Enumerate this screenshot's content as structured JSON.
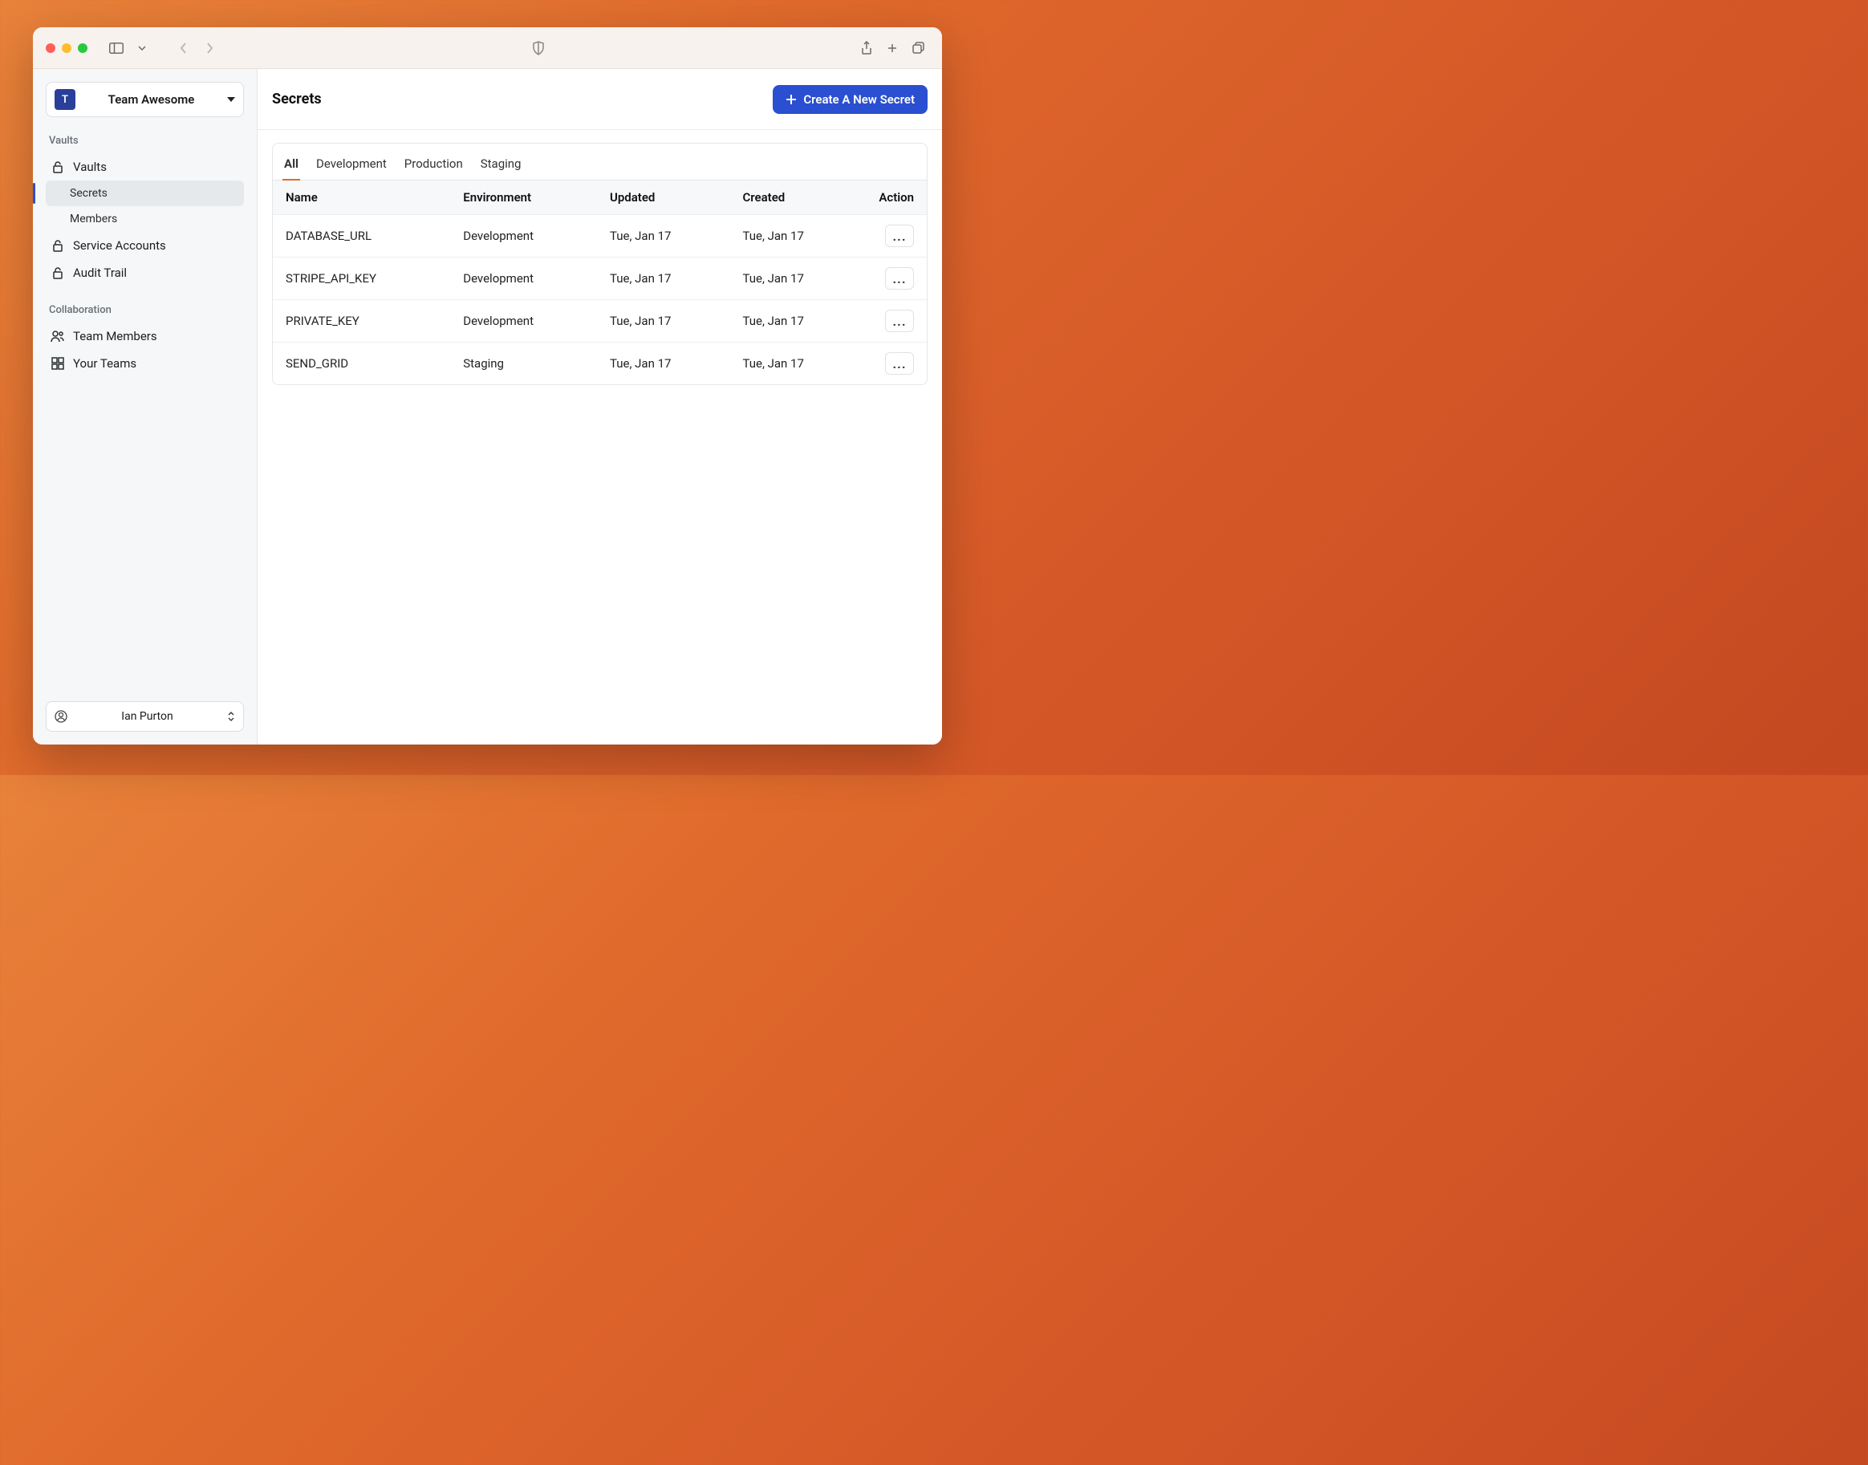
{
  "sidebar": {
    "team": {
      "badge": "T",
      "name": "Team Awesome"
    },
    "section_vaults": "Vaults",
    "nav_vaults": "Vaults",
    "nav_secrets": "Secrets",
    "nav_members": "Members",
    "nav_service_accounts": "Service Accounts",
    "nav_audit_trail": "Audit Trail",
    "section_collab": "Collaboration",
    "nav_team_members": "Team Members",
    "nav_your_teams": "Your Teams",
    "user_name": "Ian Purton"
  },
  "header": {
    "title": "Secrets",
    "create_button": "Create A New Secret"
  },
  "tabs": {
    "all": "All",
    "development": "Development",
    "production": "Production",
    "staging": "Staging"
  },
  "table": {
    "headers": {
      "name": "Name",
      "environment": "Environment",
      "updated": "Updated",
      "created": "Created",
      "action": "Action"
    },
    "rows": [
      {
        "name": "DATABASE_URL",
        "environment": "Development",
        "updated": "Tue, Jan 17",
        "created": "Tue, Jan 17"
      },
      {
        "name": "STRIPE_API_KEY",
        "environment": "Development",
        "updated": "Tue, Jan 17",
        "created": "Tue, Jan 17"
      },
      {
        "name": "PRIVATE_KEY",
        "environment": "Development",
        "updated": "Tue, Jan 17",
        "created": "Tue, Jan 17"
      },
      {
        "name": "SEND_GRID",
        "environment": "Staging",
        "updated": "Tue, Jan 17",
        "created": "Tue, Jan 17"
      }
    ],
    "row_menu": "..."
  }
}
